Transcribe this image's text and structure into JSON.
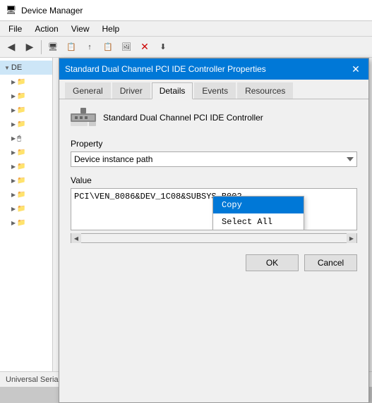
{
  "app": {
    "title": "Device Manager",
    "icon": "🖥"
  },
  "menubar": {
    "items": [
      "File",
      "Action",
      "View",
      "Help"
    ]
  },
  "toolbar": {
    "buttons": [
      "←",
      "→",
      "🖥",
      "📋",
      "📋",
      "✏",
      "📋",
      "🖼",
      "❌",
      "⬇"
    ]
  },
  "sidebar": {
    "root_label": "DE",
    "items": [
      {
        "label": "",
        "indent": 1
      },
      {
        "label": "",
        "indent": 1
      },
      {
        "label": "",
        "indent": 1
      },
      {
        "label": "",
        "indent": 1
      },
      {
        "label": "",
        "indent": 1
      },
      {
        "label": "",
        "indent": 1
      },
      {
        "label": "",
        "indent": 1
      },
      {
        "label": "",
        "indent": 1
      },
      {
        "label": "",
        "indent": 1
      },
      {
        "label": "",
        "indent": 1
      },
      {
        "label": "",
        "indent": 1
      },
      {
        "label": "",
        "indent": 1
      }
    ]
  },
  "dialog": {
    "title": "Standard Dual Channel PCI IDE Controller Properties",
    "close_label": "✕",
    "tabs": [
      {
        "label": "General",
        "active": false
      },
      {
        "label": "Driver",
        "active": false
      },
      {
        "label": "Details",
        "active": true
      },
      {
        "label": "Events",
        "active": false
      },
      {
        "label": "Resources",
        "active": false
      }
    ],
    "device_name": "Standard Dual Channel PCI IDE Controller",
    "property_label": "Property",
    "property_value": "Device instance path",
    "value_label": "Value",
    "value_text": "PCI\\VEN_8086&DEV_1C08&SUBSYS_B002",
    "context_menu": {
      "items": [
        {
          "label": "Copy",
          "highlighted": true
        },
        {
          "label": "Select All",
          "highlighted": false
        }
      ]
    },
    "buttons": {
      "ok": "OK",
      "cancel": "Cancel"
    }
  },
  "bottom_bar": {
    "text": "Universal Serial Bus controllers"
  }
}
